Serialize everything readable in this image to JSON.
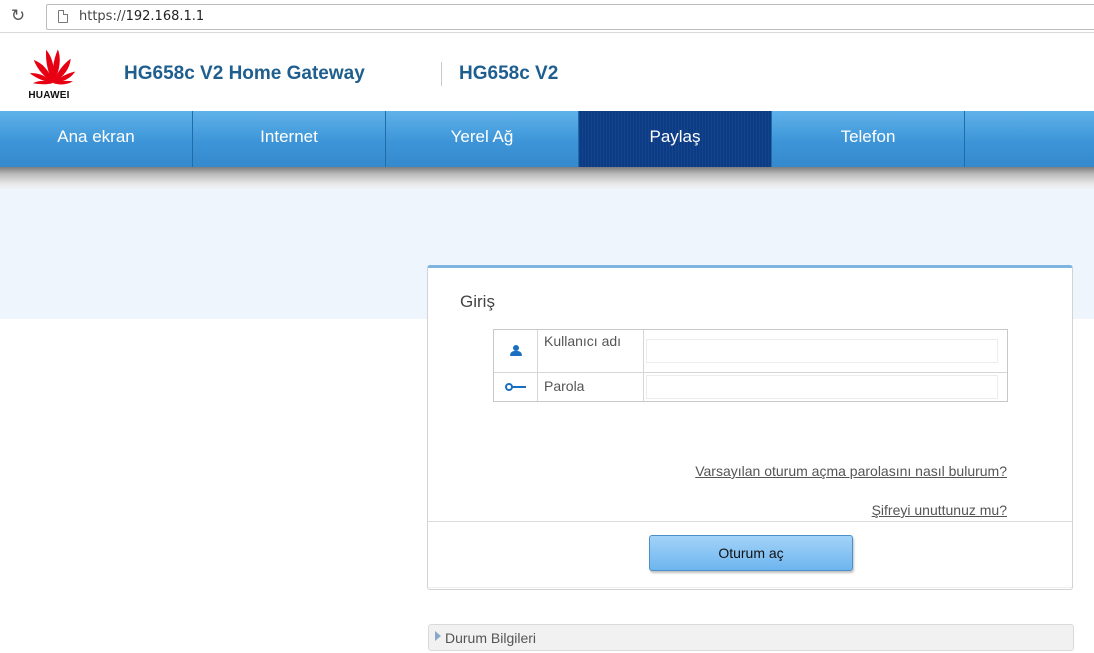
{
  "browser": {
    "url_scheme": "https://",
    "url_host": "192.168.1.1",
    "reload_icon": "↻"
  },
  "header": {
    "brand": "HUAWEI",
    "title": "HG658c V2 Home Gateway",
    "subtitle": "HG658c V2",
    "brand_color": "#e60012",
    "title_color": "#1f5f8f"
  },
  "nav": {
    "items": [
      {
        "label": "Ana ekran",
        "active": false
      },
      {
        "label": "Internet",
        "active": false
      },
      {
        "label": "Yerel Ağ",
        "active": false
      },
      {
        "label": "Paylaş",
        "active": true
      },
      {
        "label": "Telefon",
        "active": false
      }
    ],
    "bar_color": "#3d95d8",
    "active_color": "#0d3c86"
  },
  "login": {
    "title": "Giriş",
    "username_label": "Kullanıcı adı",
    "username_value": "",
    "password_label": "Parola",
    "password_value": "",
    "default_password_link": "Varsayılan oturum açma parolasını nasıl bulurum?",
    "forgot_password_link": "Şifreyi unuttunuz mu?",
    "submit_label": "Oturum aç",
    "username_icon": "user-icon",
    "password_icon": "key-icon"
  },
  "status": {
    "label": "Durum Bilgileri"
  }
}
